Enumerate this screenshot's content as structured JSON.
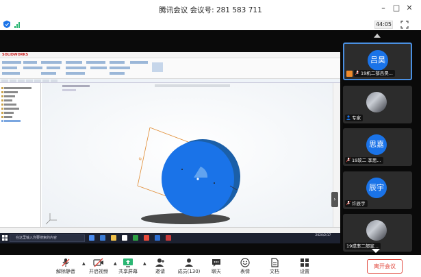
{
  "window": {
    "title": "腾讯会议 会议号: 281 583 711",
    "controls": [
      "minimize",
      "maximize",
      "close"
    ]
  },
  "status": {
    "security_icon": "shield-icon",
    "signal_icon": "signal-icon",
    "timer": "44:05",
    "fullscreen_icon": "fullscreen-icon",
    "signal_color": "#2bb673"
  },
  "shared_screen": {
    "app_logo": "SOLIDWORKS",
    "search_placeholder": "在这里输入你要搜索的内容",
    "clock": "2020/2/17",
    "model_color": "#1a73e8"
  },
  "participants": [
    {
      "avatar_text": "吕昊",
      "label": "19机二部吕昊...",
      "active": true,
      "host": true,
      "mic": "muted",
      "avatar_kind": "initials"
    },
    {
      "avatar_text": "",
      "label": "专家",
      "active": false,
      "host": false,
      "mic": "host-user",
      "avatar_kind": "photo"
    },
    {
      "avatar_text": "思嘉",
      "label": "19软二 李思...",
      "active": false,
      "host": false,
      "mic": "muted",
      "avatar_kind": "initials"
    },
    {
      "avatar_text": "辰宇",
      "label": "许辰宇",
      "active": false,
      "host": false,
      "mic": "muted",
      "avatar_kind": "initials"
    },
    {
      "avatar_text": "",
      "label": "19成率二部宣...",
      "active": false,
      "host": false,
      "mic": "none",
      "avatar_kind": "photo"
    }
  ],
  "toolbar": {
    "unmute": "解除静音",
    "start_video": "开启视频",
    "share_screen": "共享屏幕",
    "invite": "邀请",
    "members": "成员(130)",
    "chat": "聊天",
    "reactions": "表情",
    "docs": "文档",
    "settings": "设置",
    "leave": "离开会议"
  },
  "colors": {
    "accent": "#1a73e8",
    "leave": "#e0453a",
    "active_border": "#4a90e2"
  }
}
